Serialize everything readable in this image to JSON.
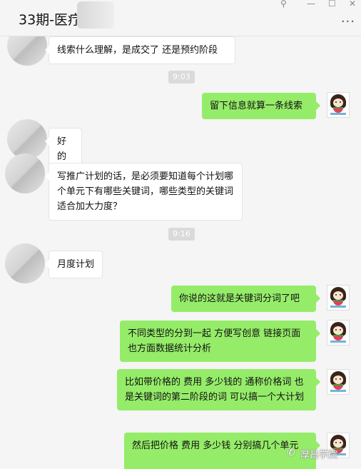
{
  "header": {
    "title": "33期-医疗-",
    "pin_icon": "pin-icon",
    "min_icon": "minimize-icon",
    "max_icon": "maximize-icon",
    "close_icon": "close-icon",
    "more_icon": "more-icon"
  },
  "messages": [
    {
      "side": "left",
      "text": "线索什么理解，是成交了 还是预约阶段"
    },
    {
      "side": "time",
      "text": "9:03"
    },
    {
      "side": "right",
      "text": "留下信息就算一条线索"
    },
    {
      "side": "left",
      "text": "好的"
    },
    {
      "side": "left",
      "text": "写推广计划的话，是必须要知道每个计划哪个单元下有哪些关键词，哪些类型的关键词适合加大力度？"
    },
    {
      "side": "time",
      "text": "9:16"
    },
    {
      "side": "left",
      "text": "月度计划"
    },
    {
      "side": "right",
      "text": "你说的这就是关键词分词了吧"
    },
    {
      "side": "right",
      "text": "不同类型的分到一起  方便写创意  链接页面  也方面数据统计分析"
    },
    {
      "side": "right",
      "text": "比如带价格的 费用 多少钱的   通称价格词   也是关键词的第二阶段的词   可以搞一个大计划"
    },
    {
      "side": "right",
      "text": "然后把价格  费用  多少钱  分别搞几个单元"
    }
  ],
  "watermark": {
    "text": "厚昌学院",
    "icon": "wechat-icon"
  },
  "colors": {
    "background": "#f5f5f5",
    "sent_bubble": "#95ec69",
    "received_bubble": "#ffffff",
    "time_badge": "#dadada"
  }
}
